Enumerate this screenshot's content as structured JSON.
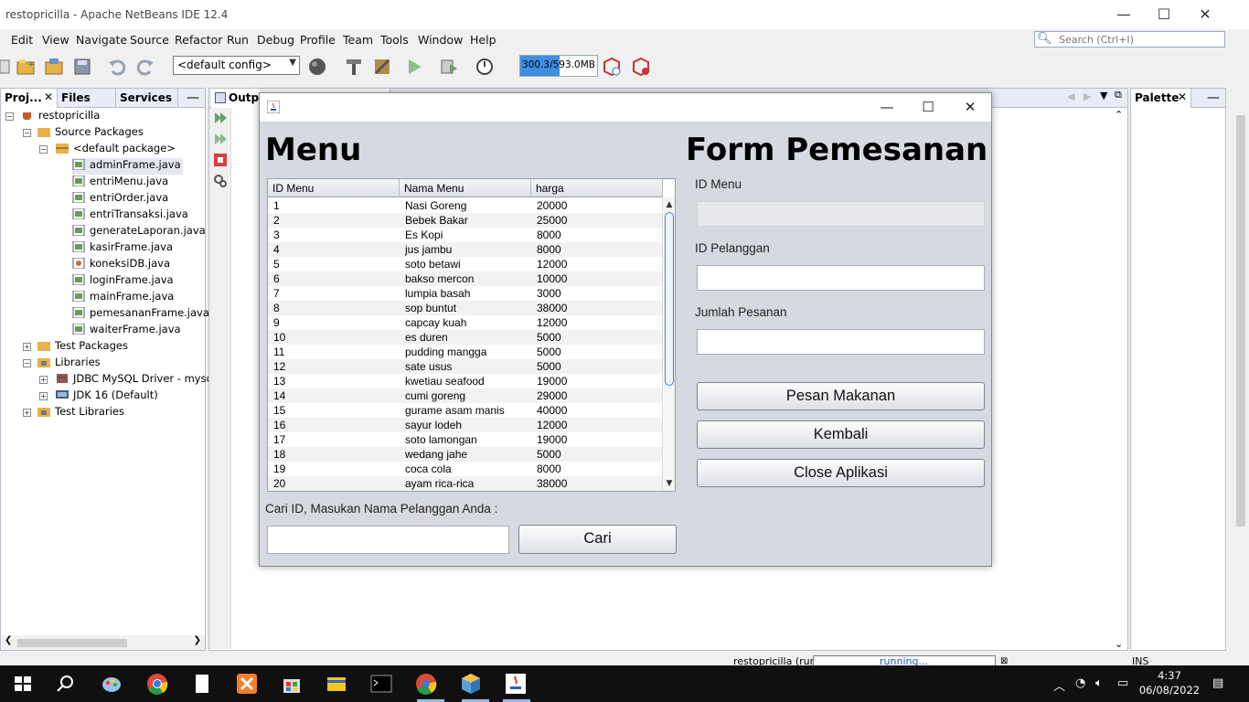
{
  "ide": {
    "title": "restopricilla - Apache NetBeans IDE 12.4",
    "menu": [
      "Edit",
      "View",
      "Navigate",
      "Source",
      "Refactor",
      "Run",
      "Debug",
      "Profile",
      "Team",
      "Tools",
      "Window",
      "Help"
    ],
    "search_placeholder": "Search (Ctrl+I)",
    "config_value": "<default config>",
    "memory_text": "300.3/593.0MB",
    "memory_fraction": 0.506,
    "left_tabs": [
      "Proj...",
      "Files",
      "Services"
    ],
    "editor_tab": "Output",
    "palette_tab": "Palette",
    "status_project": "restopricilla (run)",
    "status_running": "running...",
    "status_ins": "INS"
  },
  "tree": {
    "project": "restopricilla",
    "source_packages": "Source Packages",
    "default_package": "<default package>",
    "files": [
      "adminFrame.java",
      "entriMenu.java",
      "entriOrder.java",
      "entriTransaksi.java",
      "generateLaporan.java",
      "kasirFrame.java",
      "koneksiDB.java",
      "loginFrame.java",
      "mainFrame.java",
      "pemesananFrame.java",
      "waiterFrame.java"
    ],
    "test_packages": "Test Packages",
    "libraries": "Libraries",
    "lib_items": [
      "JDBC MySQL Driver - mysql-c",
      "JDK 16 (Default)"
    ],
    "test_libraries": "Test Libraries"
  },
  "form": {
    "menu_heading": "Menu",
    "order_heading": "Form Pemesanan",
    "columns": [
      "ID Menu",
      "Nama Menu",
      "harga"
    ],
    "rows": [
      [
        "1",
        "Nasi Goreng",
        "20000"
      ],
      [
        "2",
        "Bebek Bakar",
        "25000"
      ],
      [
        "3",
        "Es Kopi",
        "8000"
      ],
      [
        "4",
        "jus jambu",
        "8000"
      ],
      [
        "5",
        "soto betawi",
        "12000"
      ],
      [
        "6",
        "bakso mercon",
        "10000"
      ],
      [
        "7",
        "lumpia basah",
        "3000"
      ],
      [
        "8",
        "sop buntut",
        "38000"
      ],
      [
        "9",
        "capcay kuah",
        "12000"
      ],
      [
        "10",
        "es duren",
        "5000"
      ],
      [
        "11",
        "pudding mangga",
        "5000"
      ],
      [
        "12",
        "sate usus",
        "5000"
      ],
      [
        "13",
        "kwetiau seafood",
        "19000"
      ],
      [
        "14",
        "cumi goreng",
        "29000"
      ],
      [
        "15",
        "gurame asam manis",
        "40000"
      ],
      [
        "16",
        "sayur lodeh",
        "12000"
      ],
      [
        "17",
        "soto lamongan",
        "19000"
      ],
      [
        "18",
        "wedang jahe",
        "5000"
      ],
      [
        "19",
        "coca cola",
        "8000"
      ],
      [
        "20",
        "ayam rica-rica",
        "38000"
      ]
    ],
    "search_label": "Cari ID, Masukan Nama Pelanggan Anda  :",
    "search_value": "",
    "cari_button": "Cari",
    "id_menu_label": "ID Menu",
    "id_menu_value": "",
    "id_pelanggan_label": "ID Pelanggan",
    "id_pelanggan_value": "",
    "jumlah_label": "Jumlah Pesanan",
    "jumlah_value": "",
    "pesan_button": "Pesan Makanan",
    "kembali_button": "Kembali",
    "close_button": "Close Aplikasi"
  },
  "taskbar": {
    "time": "4:37",
    "date": "06/08/2022"
  }
}
